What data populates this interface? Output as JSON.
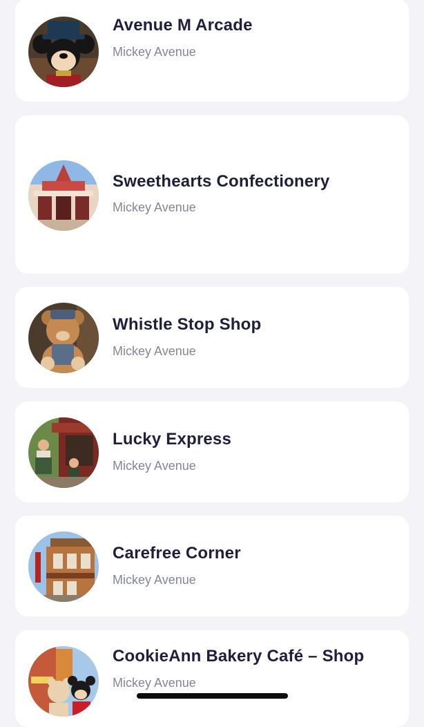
{
  "shops": [
    {
      "name": "Avenue M Arcade",
      "area": "Mickey Avenue",
      "thumbnail_icon": "mickey-plush-photo"
    },
    {
      "name": "Sweethearts Confectionery",
      "area": "Mickey Avenue",
      "thumbnail_icon": "storefront-photo"
    },
    {
      "name": "Whistle Stop Shop",
      "area": "Mickey Avenue",
      "thumbnail_icon": "bear-plush-photo"
    },
    {
      "name": "Lucky Express",
      "area": "Mickey Avenue",
      "thumbnail_icon": "shop-cast-members-photo"
    },
    {
      "name": "Carefree Corner",
      "area": "Mickey Avenue",
      "thumbnail_icon": "corner-building-photo"
    },
    {
      "name": "CookieAnn Bakery Café – Shop",
      "area": "Mickey Avenue",
      "thumbnail_icon": "characters-photo"
    }
  ],
  "colors": {
    "background": "#f3f3f8",
    "card": "#ffffff",
    "title": "#1d1f3c",
    "subtitle": "#83869a"
  }
}
